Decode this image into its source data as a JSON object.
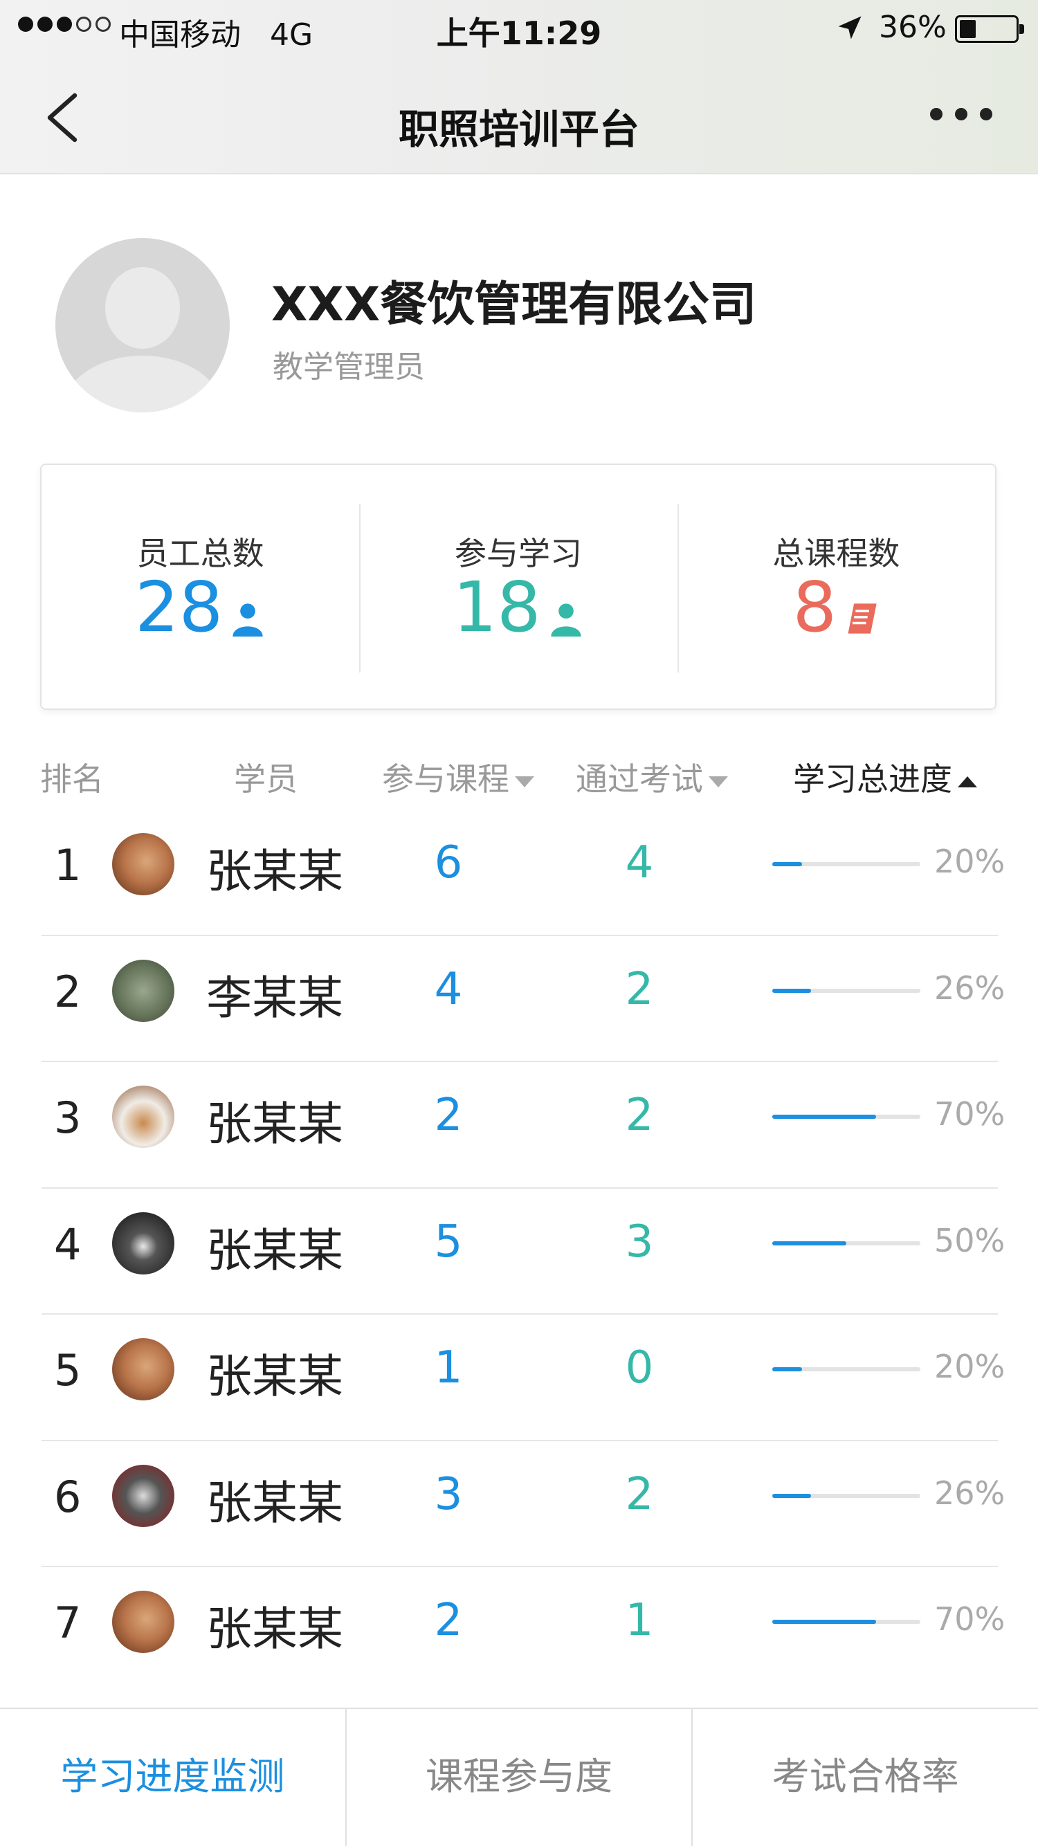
{
  "status_bar": {
    "carrier": "中国移动",
    "network": "4G",
    "time": "上午11:29",
    "battery_text": "36%",
    "battery_level": 0.36
  },
  "nav": {
    "title": "职照培训平台",
    "back_icon": "chevron-left-icon",
    "more_icon": "more-horizontal-icon"
  },
  "profile": {
    "company": "XXX餐饮管理有限公司",
    "role": "教学管理员"
  },
  "stats": [
    {
      "label": "员工总数",
      "value": "28",
      "icon": "person-icon",
      "color": "#1b8fe0"
    },
    {
      "label": "参与学习",
      "value": "18",
      "icon": "person-icon",
      "color": "#35b8a8"
    },
    {
      "label": "总课程数",
      "value": "8",
      "icon": "book-icon",
      "color": "#ea6b5c"
    }
  ],
  "table": {
    "headers": {
      "rank": "排名",
      "student": "学员",
      "courses": "参与课程",
      "passed": "通过考试",
      "progress": "学习总进度"
    },
    "sort": {
      "column": "progress",
      "direction": "ascending"
    },
    "rows": [
      {
        "rank": "1",
        "name": "张某某",
        "courses": "6",
        "passed": "4",
        "progress_text": "20%",
        "progress": 0.2
      },
      {
        "rank": "2",
        "name": "李某某",
        "courses": "4",
        "passed": "2",
        "progress_text": "26%",
        "progress": 0.26
      },
      {
        "rank": "3",
        "name": "张某某",
        "courses": "2",
        "passed": "2",
        "progress_text": "70%",
        "progress": 0.7
      },
      {
        "rank": "4",
        "name": "张某某",
        "courses": "5",
        "passed": "3",
        "progress_text": "50%",
        "progress": 0.5
      },
      {
        "rank": "5",
        "name": "张某某",
        "courses": "1",
        "passed": "0",
        "progress_text": "20%",
        "progress": 0.2
      },
      {
        "rank": "6",
        "name": "张某某",
        "courses": "3",
        "passed": "2",
        "progress_text": "26%",
        "progress": 0.26
      },
      {
        "rank": "7",
        "name": "张某某",
        "courses": "2",
        "passed": "1",
        "progress_text": "70%",
        "progress": 0.7
      }
    ]
  },
  "tabs": [
    {
      "label": "学习进度监测",
      "active": true
    },
    {
      "label": "课程参与度",
      "active": false
    },
    {
      "label": "考试合格率",
      "active": false
    }
  ],
  "colors": {
    "accent": "#1b8fe0",
    "teal": "#35b8a8",
    "coral": "#ea6b5c"
  }
}
